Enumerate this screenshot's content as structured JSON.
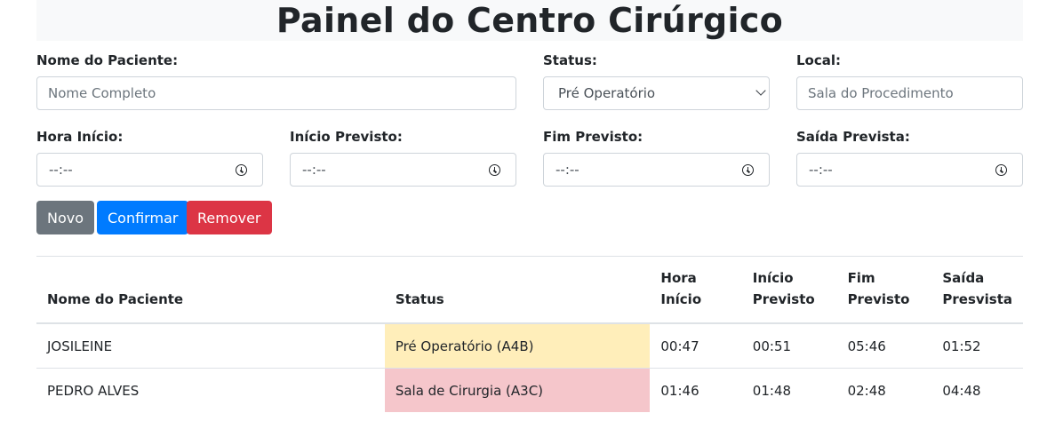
{
  "page": {
    "title": "Painel do Centro Cirúrgico"
  },
  "form": {
    "patient_label": "Nome do Paciente:",
    "patient_placeholder": "Nome Completo",
    "status_label": "Status:",
    "status_value": "Pré Operatório",
    "local_label": "Local:",
    "local_placeholder": "Sala do Procedimento",
    "hora_inicio_label": "Hora Início:",
    "inicio_previsto_label": "Início Previsto:",
    "fim_previsto_label": "Fim Previsto:",
    "saida_prevista_label": "Saída Prevista:",
    "time_placeholder": "--:--"
  },
  "buttons": {
    "novo": "Novo",
    "confirmar": "Confirmar",
    "remover": "Remover"
  },
  "table": {
    "headers": [
      "Nome do Paciente",
      "Status",
      "Hora Início",
      "Início Previsto",
      "Fim Previsto",
      "Saída Presvista"
    ],
    "rows": [
      {
        "name": "JOSILEINE",
        "status": "Pré Operatório (A4B)",
        "status_color": "#ffeeba",
        "hora_inicio": "00:47",
        "inicio_previsto": "00:51",
        "fim_previsto": "05:46",
        "saida": "01:52"
      },
      {
        "name": "PEDRO ALVES",
        "status": "Sala de Cirurgia (A3C)",
        "status_color": "#f5c6cb",
        "hora_inicio": "01:46",
        "inicio_previsto": "01:48",
        "fim_previsto": "02:48",
        "saida": "04:48"
      }
    ]
  },
  "colors": {
    "secondary": "#6c757d",
    "primary": "#007bff",
    "danger": "#dc3545"
  }
}
